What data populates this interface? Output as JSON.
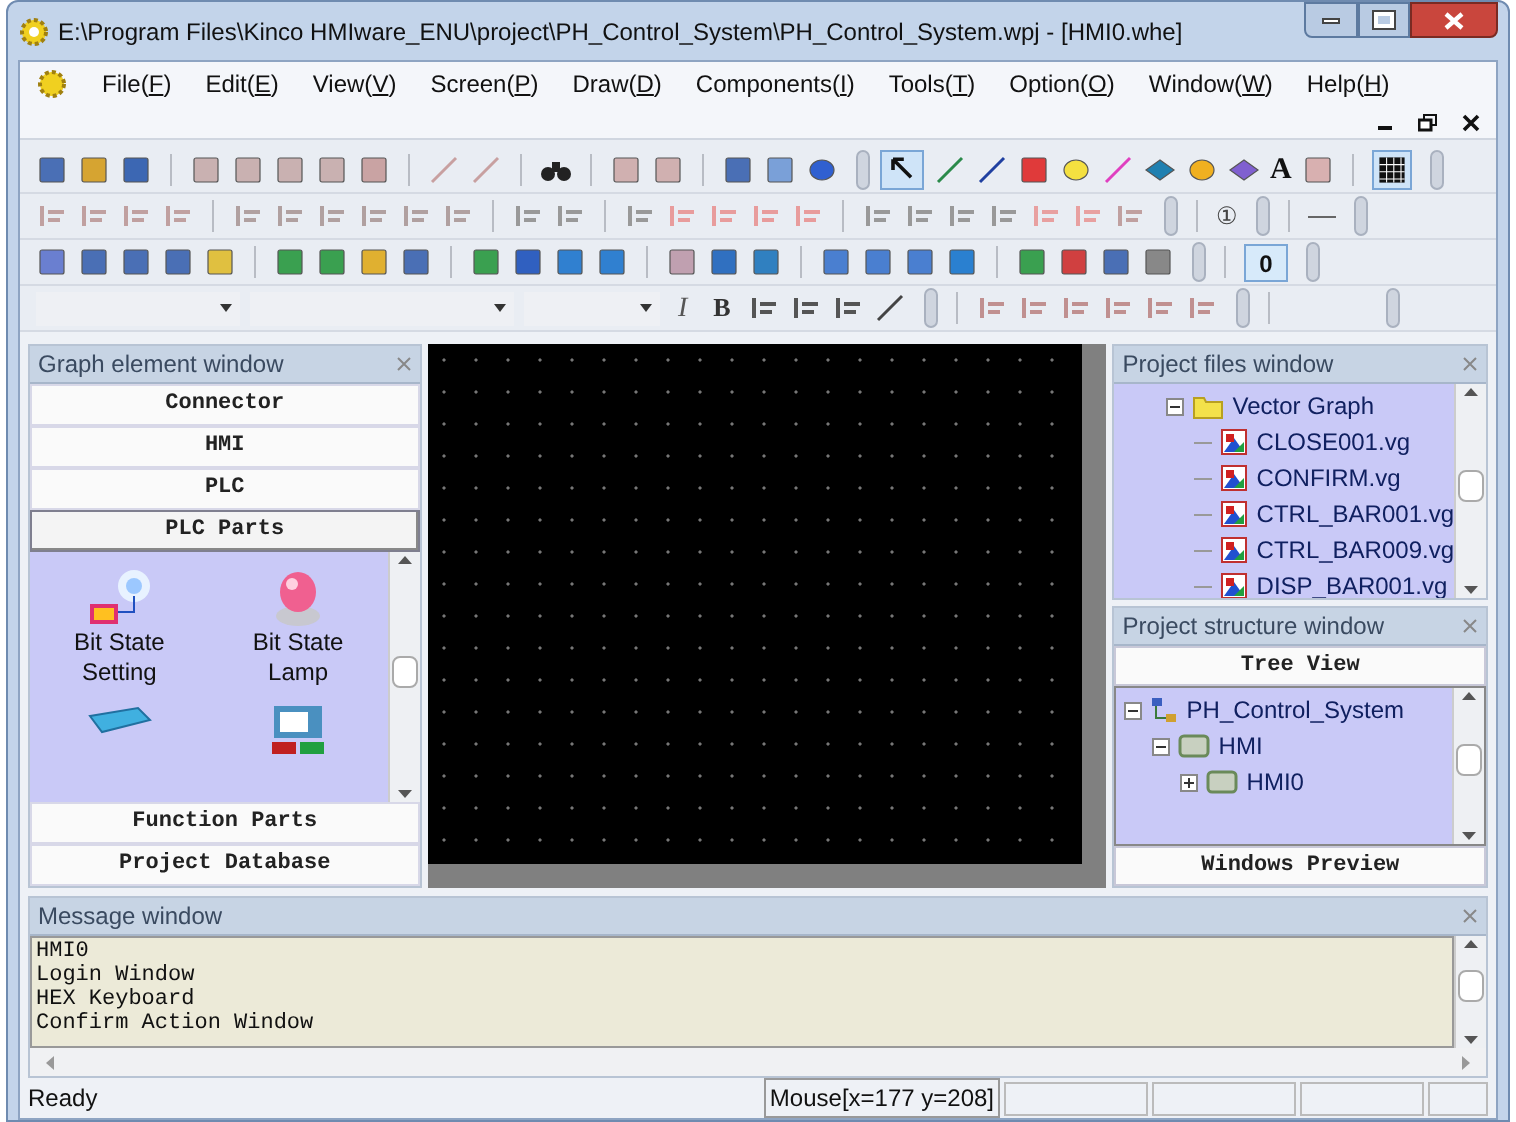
{
  "window": {
    "title": "E:\\Program Files\\Kinco HMIware_ENU\\project\\PH_Control_System\\PH_Control_System.wpj - [HMI0.whe]"
  },
  "menu": [
    {
      "text": "File(",
      "mnemonic": "F",
      "end": ")"
    },
    {
      "text": "Edit(",
      "mnemonic": "E",
      "end": ")"
    },
    {
      "text": "View(",
      "mnemonic": "V",
      "end": ")"
    },
    {
      "text": "Screen(",
      "mnemonic": "P",
      "end": ")"
    },
    {
      "text": "Draw(",
      "mnemonic": "D",
      "end": ")"
    },
    {
      "text": "Components(",
      "mnemonic": "I",
      "end": ")"
    },
    {
      "text": "Tools(",
      "mnemonic": "T",
      "end": ")"
    },
    {
      "text": "Option(",
      "mnemonic": "O",
      "end": ")"
    },
    {
      "text": "Window(",
      "mnemonic": "W",
      "end": ")"
    },
    {
      "text": "Help(",
      "mnemonic": "H",
      "end": ")"
    }
  ],
  "toolbar": {
    "text_tool": "A",
    "grid_value": "0",
    "italic": "I",
    "bold": "B",
    "number_tool": "①"
  },
  "graph_element_window": {
    "title": "Graph element window",
    "sections_top": [
      {
        "label": "Connector",
        "selected": false
      },
      {
        "label": "HMI",
        "selected": false
      },
      {
        "label": "PLC",
        "selected": false
      },
      {
        "label": "PLC Parts",
        "selected": true
      }
    ],
    "parts": [
      {
        "label": "Bit State Setting",
        "kind": "switch"
      },
      {
        "label": "Bit State Lamp",
        "kind": "lamp"
      },
      {
        "kind": "button"
      },
      {
        "kind": "screen"
      }
    ],
    "sections_bottom": [
      {
        "label": "Function Parts",
        "selected": false
      },
      {
        "label": "Project Database",
        "selected": false
      }
    ]
  },
  "project_files_window": {
    "title": "Project files window",
    "tree": [
      {
        "label": "Vector Graph",
        "expanded": true,
        "children": [
          {
            "label": "CLOSE001.vg"
          },
          {
            "label": "CONFIRM.vg"
          },
          {
            "label": "CTRL_BAR001.vg"
          },
          {
            "label": "CTRL_BAR009.vg"
          },
          {
            "label": "DISP_BAR001.vg"
          }
        ]
      }
    ]
  },
  "project_structure_window": {
    "title": "Project structure window",
    "top_button": "Tree View",
    "tree": [
      {
        "label": "PH_Control_System",
        "expanded": true,
        "kind": "root",
        "children": [
          {
            "label": "HMI",
            "expanded": true,
            "kind": "device",
            "children": [
              {
                "label": "HMI0",
                "expanded": false,
                "kind": "device"
              }
            ]
          }
        ]
      }
    ],
    "bottom_button": "Windows Preview"
  },
  "message_window": {
    "title": "Message window",
    "lines": [
      "HMI0",
      "Login Window",
      "HEX Keyboard",
      "Confirm Action Window"
    ]
  },
  "status_bar": {
    "text": "Ready",
    "mouse": "Mouse[x=177  y=208]"
  }
}
